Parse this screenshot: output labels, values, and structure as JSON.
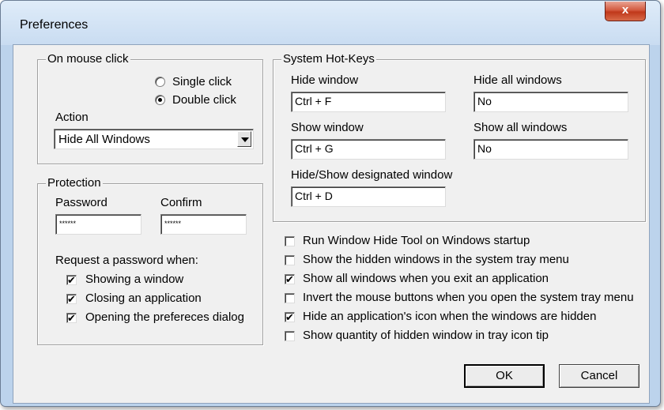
{
  "window": {
    "title": "Preferences",
    "close_label": "x"
  },
  "mouse_click": {
    "group_label": "On mouse click",
    "single_click_label": "Single click",
    "double_click_label": "Double click",
    "selected": "Double click",
    "action_label": "Action",
    "action_value": "Hide All Windows"
  },
  "protection": {
    "group_label": "Protection",
    "password_label": "Password",
    "confirm_label": "Confirm",
    "password_value": "******",
    "confirm_value": "******",
    "request_label": "Request a password when:",
    "options": [
      {
        "label": "Showing a window",
        "checked": true
      },
      {
        "label": "Closing an application",
        "checked": true
      },
      {
        "label": "Opening the prefereces dialog",
        "checked": true
      }
    ]
  },
  "hotkeys": {
    "group_label": "System Hot-Keys",
    "hide_window_label": "Hide window",
    "hide_window_value": "Ctrl + F",
    "hide_all_label": "Hide all windows",
    "hide_all_value": "No",
    "show_window_label": "Show window",
    "show_window_value": "Ctrl + G",
    "show_all_label": "Show all windows",
    "show_all_value": "No",
    "designated_label": "Hide/Show designated window",
    "designated_value": "Ctrl + D"
  },
  "options": [
    {
      "label": "Run Window Hide Tool on Windows startup",
      "checked": false
    },
    {
      "label": "Show the hidden windows in the system tray menu",
      "checked": false
    },
    {
      "label": "Show all windows when you exit an application",
      "checked": true
    },
    {
      "label": "Invert the mouse buttons when you open the system tray menu",
      "checked": false
    },
    {
      "label": "Hide an application's icon when the windows are hidden",
      "checked": true
    },
    {
      "label": "Show quantity of hidden window in tray icon tip",
      "checked": false
    }
  ],
  "buttons": {
    "ok_label": "OK",
    "cancel_label": "Cancel"
  },
  "check_mark": "✔"
}
